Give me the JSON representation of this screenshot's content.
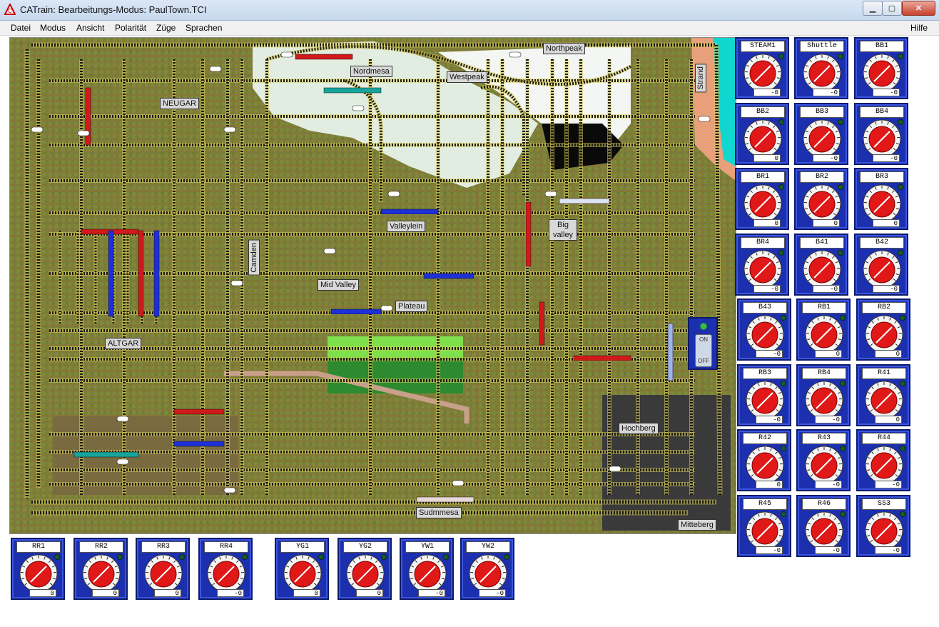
{
  "window": {
    "title": "CATrain: Bearbeitungs-Modus: PaulTown.TCI",
    "icon": "catrain-app-icon",
    "controls": {
      "minimize": "▁",
      "maximize": "▢",
      "close": "✕"
    }
  },
  "menu": {
    "items": [
      "Datei",
      "Modus",
      "Ansicht",
      "Polarität",
      "Züge",
      "Sprachen"
    ],
    "help": "Hilfe"
  },
  "layout": {
    "station_labels": {
      "neugar": "NEUGAR",
      "altgar": "ALTGAR",
      "nordmesa": "Nordmesa",
      "westpeak": "Westpeak",
      "northpeak": "Northpeak",
      "strand": "Strand",
      "valleylein": "Valleylein",
      "big_valley_1": "Big",
      "big_valley_2": "valley",
      "camden": "Camden",
      "mid_valley": "Mid Valley",
      "plateau": "Plateau",
      "hochberg": "Hochberg",
      "sudmmesa": "Sudmmesa",
      "mitteberg": "Mitteberg"
    },
    "power_switch": {
      "on": "ON",
      "off": "OFF"
    }
  },
  "throttles_right": [
    {
      "name": "STEAM1",
      "value": "-0"
    },
    {
      "name": "Shuttle",
      "value": "-0"
    },
    {
      "name": "BB1",
      "value": "-0"
    },
    {
      "name": "BB2",
      "value": "0"
    },
    {
      "name": "BB3",
      "value": "-0"
    },
    {
      "name": "BB4",
      "value": "-0"
    },
    {
      "name": "BR1",
      "value": "0"
    },
    {
      "name": "BR2",
      "value": "0"
    },
    {
      "name": "BR3",
      "value": "0"
    },
    {
      "name": "BR4",
      "value": "-0"
    },
    {
      "name": "B41",
      "value": "-0"
    },
    {
      "name": "B42",
      "value": "-0"
    },
    {
      "name": "B43",
      "value": "-0"
    },
    {
      "name": "RB1",
      "value": "0"
    },
    {
      "name": "RB2",
      "value": "0"
    },
    {
      "name": "RB3",
      "value": "-0"
    },
    {
      "name": "RB4",
      "value": "-0"
    },
    {
      "name": "R41",
      "value": "0"
    },
    {
      "name": "R42",
      "value": "0"
    },
    {
      "name": "R43",
      "value": "-0"
    },
    {
      "name": "R44",
      "value": "-0"
    },
    {
      "name": "R45",
      "value": "-0"
    },
    {
      "name": "R46",
      "value": "-0"
    },
    {
      "name": "SS3",
      "value": "-0"
    }
  ],
  "throttles_bottom": [
    {
      "name": "RR1",
      "value": "0"
    },
    {
      "name": "RR2",
      "value": "0"
    },
    {
      "name": "RR3",
      "value": "0"
    },
    {
      "name": "RR4",
      "value": "-0"
    },
    {
      "name": "YG1",
      "value": "0"
    },
    {
      "name": "YG2",
      "value": "0"
    },
    {
      "name": "YW1",
      "value": "-0"
    },
    {
      "name": "YW2",
      "value": "-0"
    }
  ],
  "colors": {
    "track": "#1e1a10",
    "ground": "#7d7c3a",
    "throttle_blue": "#1c2fae",
    "dial_red": "#e01818",
    "train_red": "#d01a1a",
    "train_blue": "#1d2fd6",
    "snow": "#e8f2ea",
    "sea": "#10d6d0",
    "sand": "#e8a07a"
  }
}
